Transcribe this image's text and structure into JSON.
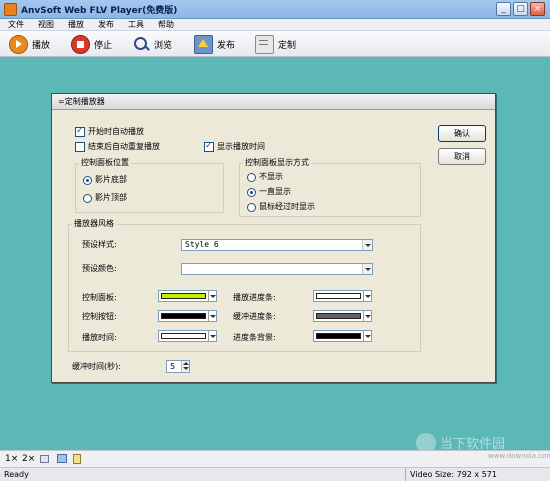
{
  "window": {
    "title": "AnvSoft Web FLV Player(免费版)"
  },
  "menu": [
    "文件",
    "视图",
    "播放",
    "发布",
    "工具",
    "帮助"
  ],
  "toolbar": {
    "play": "播放",
    "stop": "停止",
    "browse": "浏览",
    "publish": "发布",
    "customize": "定制"
  },
  "dialog": {
    "title": "=定制播放器",
    "ok": "确认",
    "cancel": "取消",
    "autoplay": "开始时自动播放",
    "autoreplay": "结束后自动重复播放",
    "show_time": "显示播放时间",
    "panel_position": {
      "title": "控制面板位置",
      "bottom": "影片底部",
      "top": "影片顶部"
    },
    "panel_display": {
      "title": "控制面板显示方式",
      "hide": "不显示",
      "always": "一直显示",
      "hover": "鼠标经过时显示"
    },
    "style_group": {
      "title": "播放器风格",
      "preset_style_label": "预设样式:",
      "preset_style_value": "Style 6",
      "preset_color_label": "预设颜色:",
      "preset_color_value": "",
      "control_panel": "控制面板:",
      "control_button": "控制按钮:",
      "play_time": "播放时间:",
      "play_progress": "播放进度条:",
      "buffer_progress": "缓冲进度条:",
      "progress_bg": "进度条背景:"
    },
    "buffer_label": "缓冲时间(秒):",
    "buffer_value": "5"
  },
  "colors": {
    "control_panel": "#c3f000",
    "control_button": "#000000",
    "play_time": "#ffffff",
    "play_progress": "#ffffff",
    "buffer_progress": "#606060",
    "progress_bg": "#000000",
    "workspace": "#5cb7b7"
  },
  "bottom_bar": {
    "zoom1": "1×",
    "zoom2": "2×"
  },
  "status": {
    "left": "Ready",
    "right": "Video Size: 792 x 571"
  },
  "watermark": {
    "line1": "当下软件园",
    "line2": "www.downxia.com"
  }
}
